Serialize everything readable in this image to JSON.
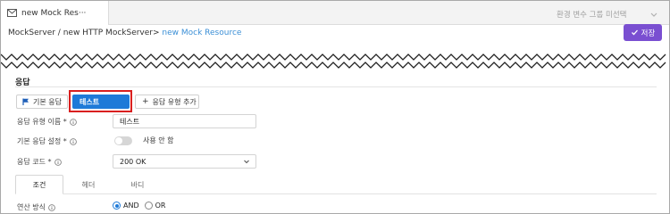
{
  "tab": {
    "title": "new Mock Res···",
    "icon": "mail-icon"
  },
  "env_select": {
    "placeholder": "환경 변수 그룹 미선택"
  },
  "breadcrumb": {
    "path": "MockServer / new HTTP MockServer> ",
    "current": "new Mock Resource"
  },
  "save_button": {
    "label": "저장"
  },
  "section": {
    "title": "응답"
  },
  "response_tabs": [
    {
      "label": "기본 응답",
      "icon": "flag-icon"
    },
    {
      "label": "테스트"
    },
    {
      "label": "응답 유형 추가",
      "icon": "plus-icon"
    }
  ],
  "form": {
    "type_name": {
      "label": "응답 유형 이름 *",
      "value": "테스트"
    },
    "default_setting": {
      "label": "기본 응답 설정 *",
      "toggle_label": "사용 안 함",
      "enabled": false
    },
    "code": {
      "label": "응답 코드 *",
      "value": "200 OK"
    }
  },
  "content_tabs": [
    "조건",
    "헤더",
    "바디"
  ],
  "match": {
    "label": "연산 방식",
    "options": [
      "AND",
      "OR"
    ],
    "selected": "AND"
  },
  "colors": {
    "accent": "#1e7ad8",
    "save": "#7a4fd1",
    "highlight": "#d91f1f",
    "link": "#3b8fd6"
  }
}
